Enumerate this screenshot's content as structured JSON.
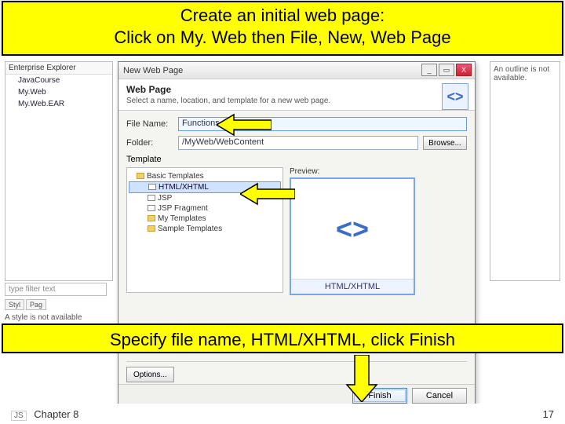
{
  "banner": {
    "line1": "Create an initial web page:",
    "line2": "Click on My. Web then File, New, Web Page",
    "mid": "Specify file name, HTML/XHTML, click Finish"
  },
  "explorer": {
    "title": "Enterprise Explorer",
    "items": [
      "JavaCourse",
      "My.Web",
      "My.Web.EAR"
    ]
  },
  "outline": {
    "text": "An outline is not available."
  },
  "filter": {
    "placeholder": "type filter text"
  },
  "mini_tabs": {
    "t1": "Styl",
    "t2": "Pag"
  },
  "no_style": "A style is not available",
  "dialog": {
    "title": "New Web Page",
    "heading": "Web Page",
    "subheading": "Select a name, location, and template for a new web page.",
    "window_buttons": {
      "close": "X"
    },
    "file_name_label": "File Name:",
    "file_name_value": "Functions",
    "folder_label": "Folder:",
    "folder_value": "/MyWeb/WebContent",
    "browse": "Browse...",
    "template_label": "Template",
    "preview_label": "Preview:",
    "tree": {
      "root": "Basic Templates",
      "items": [
        "HTML/XHTML",
        "JSP",
        "JSP Fragment",
        "My Templates",
        "Sample Templates"
      ]
    },
    "preview_caption": "HTML/XHTML",
    "code_glyph": "<>",
    "options": "Options...",
    "finish": "Finish",
    "cancel": "Cancel"
  },
  "footer": {
    "js": "JS",
    "chapter": "Chapter 8",
    "page": "17"
  }
}
